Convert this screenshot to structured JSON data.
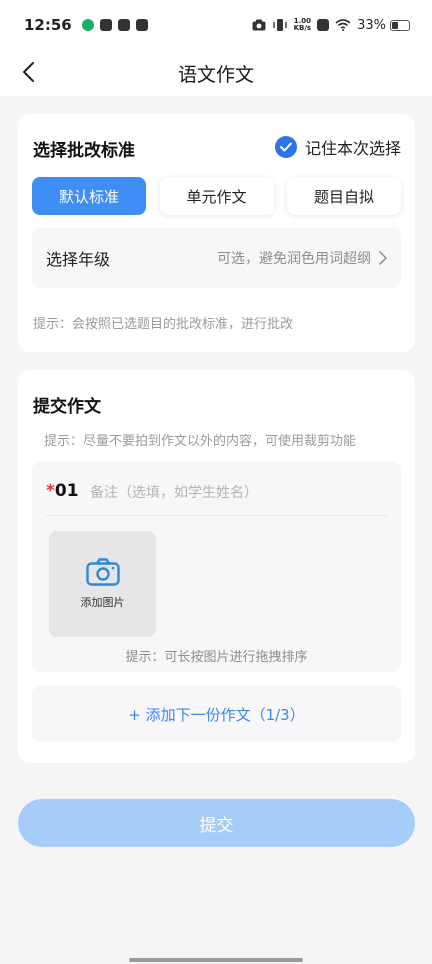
{
  "status_bar": {
    "time": "12:56",
    "speed_value": "1.00",
    "speed_unit": "KB/s",
    "battery": "33%",
    "icons": [
      "green-dot-icon",
      "inbox-icon",
      "link-icon",
      "chat-icon",
      "camera-icon",
      "vibrate-icon",
      "x-icon",
      "wifi-icon",
      "battery-icon"
    ]
  },
  "nav": {
    "title": "语文作文",
    "back_icon": "chevron-left-icon"
  },
  "criteria": {
    "title": "选择批改标准",
    "remember_label": "记住本次选择",
    "remember_checked": true,
    "options": [
      {
        "label": "默认标准",
        "selected": true
      },
      {
        "label": "单元作文",
        "selected": false
      },
      {
        "label": "题目自拟",
        "selected": false
      }
    ],
    "grade": {
      "label": "选择年级",
      "placeholder": "可选，避免润色用词超纲"
    },
    "hint": "提示：会按照已选题目的批改标准，进行批改"
  },
  "submission": {
    "title": "提交作文",
    "hint": "提示：尽量不要拍到作文以外的内容，可使用裁剪功能",
    "essays": [
      {
        "required_mark": "*",
        "number": "01",
        "note_placeholder": "备注（选填，如学生姓名）",
        "add_image_label": "添加图片",
        "sort_hint": "提示：可长按图片进行拖拽排序"
      }
    ],
    "add_next_label": "+ 添加下一份作文（1/3）"
  },
  "submit_label": "提交",
  "colors": {
    "accent": "#3f8ef5",
    "check": "#2f74e6",
    "link": "#3a86ef",
    "submit_disabled": "#a6cdf9",
    "required": "#e23b3b"
  }
}
